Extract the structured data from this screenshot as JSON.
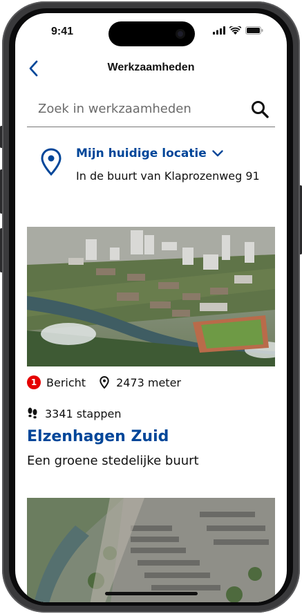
{
  "status_bar": {
    "time": "9:41"
  },
  "nav": {
    "title": "Werkzaamheden"
  },
  "search": {
    "placeholder": "Zoek in werkzaamheden",
    "value": ""
  },
  "location": {
    "title": "Mijn huidige locatie",
    "subtitle": "In de buurt van Klaprozenweg 91"
  },
  "cards": [
    {
      "notification_count": "1",
      "notification_label": "Bericht",
      "distance": "2473 meter",
      "steps": "3341 stappen",
      "title": "Elzenhagen Zuid",
      "subtitle": "Een groene stedelijke buurt"
    }
  ],
  "colors": {
    "brand": "#004699",
    "badge": "#e50000",
    "text": "#111111"
  },
  "icons": [
    "back-chevron-icon",
    "search-icon",
    "location-pin-icon",
    "chevron-down-icon",
    "map-marker-icon",
    "footsteps-icon"
  ]
}
